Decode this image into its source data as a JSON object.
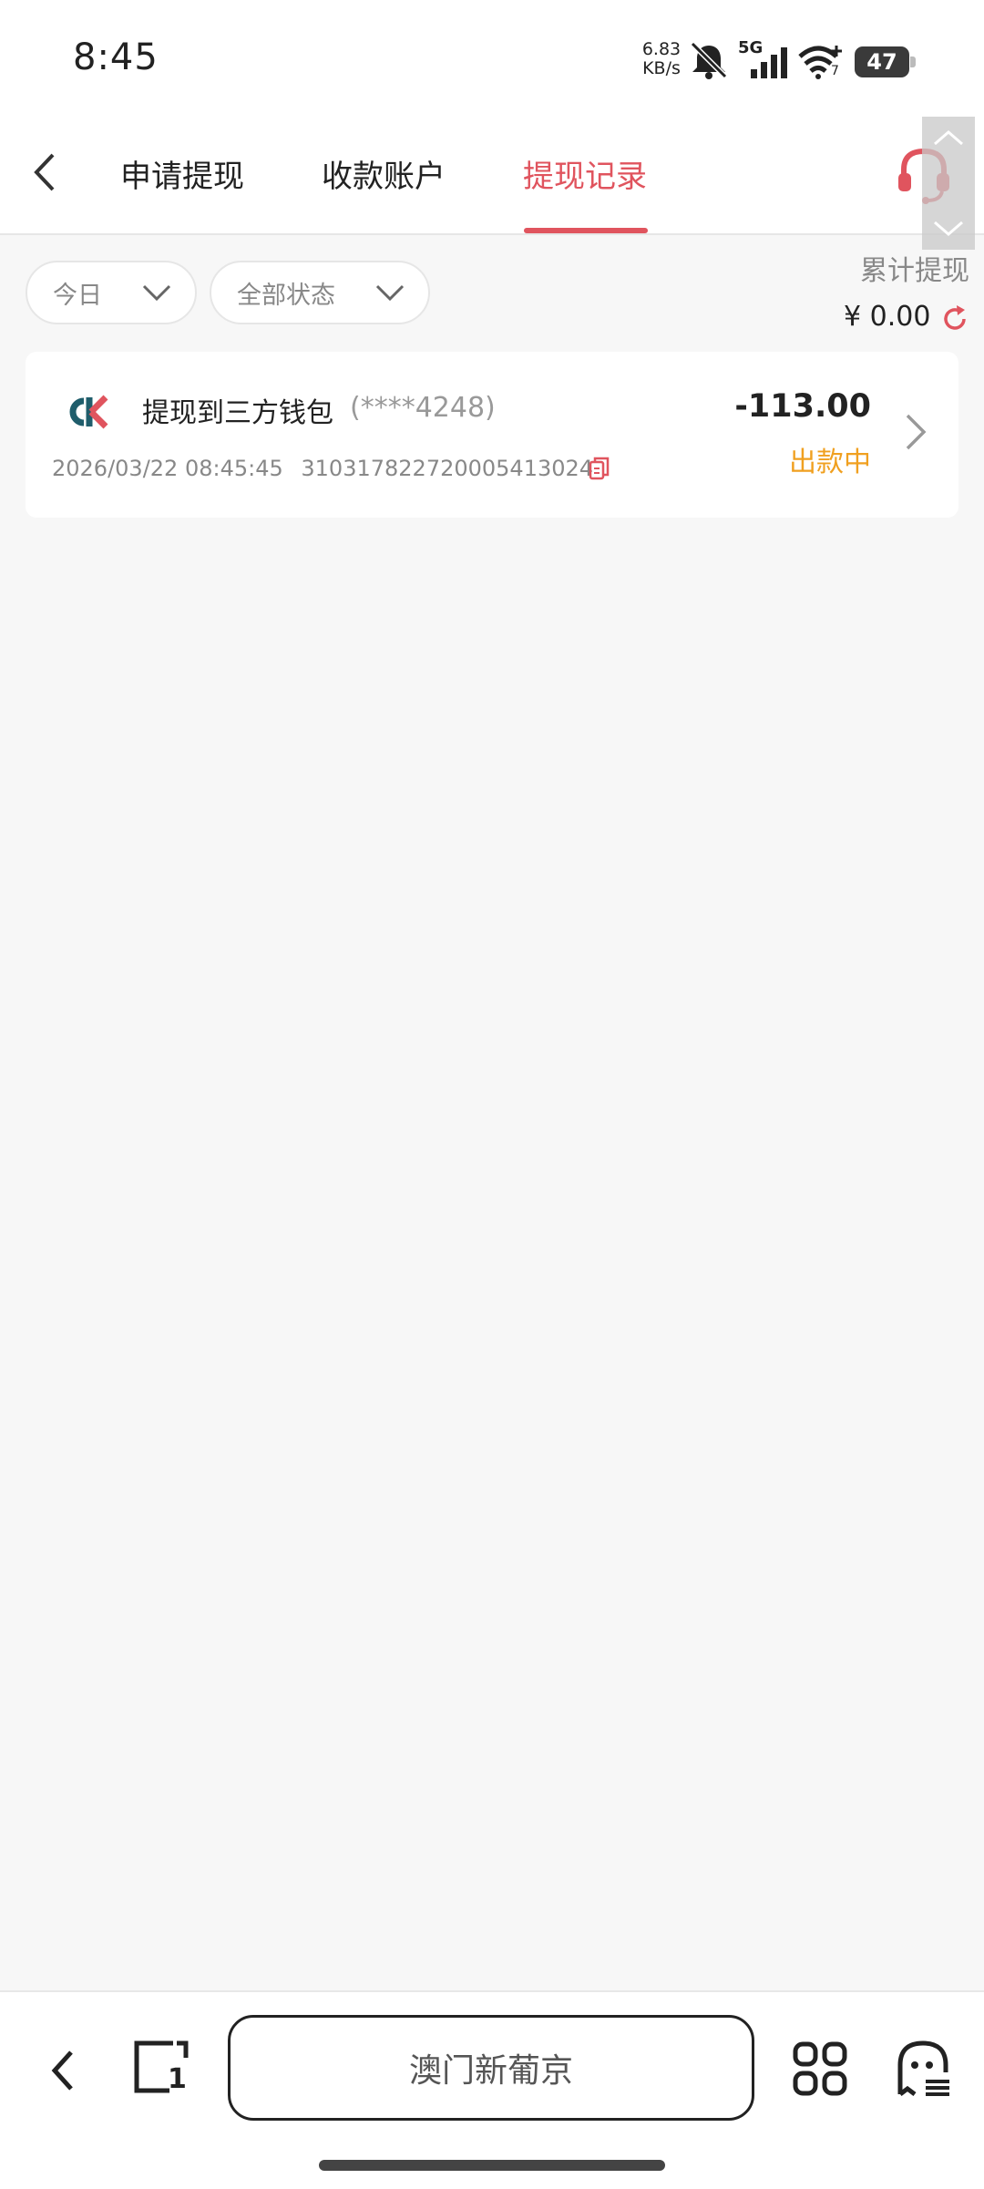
{
  "status_bar": {
    "time": "8:45",
    "net_speed_value": "6.83",
    "net_speed_unit": "KB/s",
    "network": "5G",
    "wifi_badge": "7",
    "battery": "47"
  },
  "header": {
    "tabs": [
      {
        "label": "申请提现",
        "active": false
      },
      {
        "label": "收款账户",
        "active": false
      },
      {
        "label": "提现记录",
        "active": true
      }
    ],
    "accent_color": "#e0545e"
  },
  "filters": {
    "date": "今日",
    "status": "全部状态"
  },
  "summary": {
    "label": "累计提现",
    "value": "¥ 0.00"
  },
  "records": [
    {
      "title": "提现到三方钱包",
      "account": "(****4248)",
      "datetime": "2026/03/22 08:45:45",
      "order_no": "310317822720005413024",
      "amount": "-113.00",
      "status": "出款中",
      "status_color": "#f0a020"
    }
  ],
  "bottom_bar": {
    "url_title": "澳门新葡京",
    "tab_count": "1"
  }
}
